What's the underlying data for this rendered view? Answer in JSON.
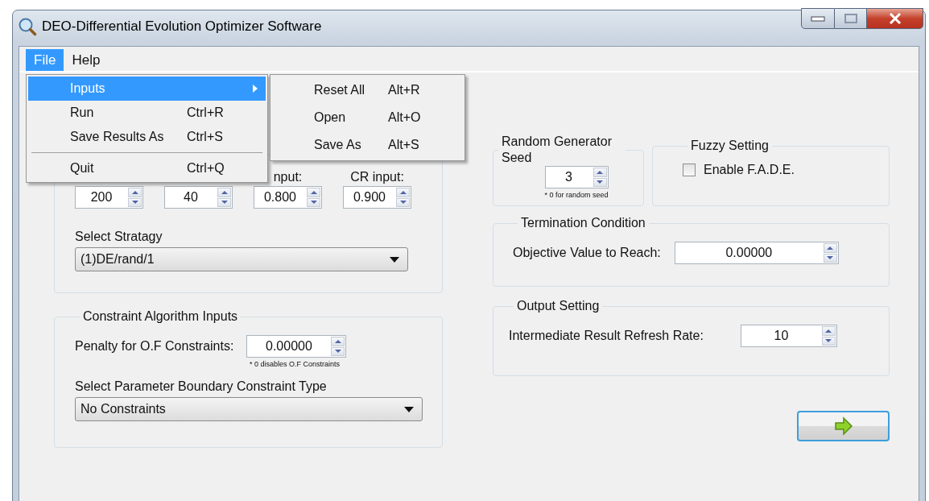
{
  "window": {
    "title": "DEO-Differential Evolution Optimizer Software"
  },
  "menu_bar": [
    {
      "label": "File",
      "selected": true
    },
    {
      "label": "Help",
      "selected": false
    }
  ],
  "file_menu": [
    {
      "kind": "submenu",
      "label": "Inputs",
      "selected": true
    },
    {
      "kind": "command",
      "label": "Run",
      "shortcut": "Ctrl+R",
      "selected": false
    },
    {
      "kind": "command",
      "label": "Save Results As",
      "shortcut": "Ctrl+S",
      "selected": false
    },
    {
      "kind": "separator"
    },
    {
      "kind": "command",
      "label": "Quit",
      "shortcut": "Ctrl+Q",
      "selected": false
    }
  ],
  "inputs_submenu": [
    {
      "label": "Reset All",
      "shortcut": "Alt+R"
    },
    {
      "label": "Open",
      "shortcut": "Alt+O"
    },
    {
      "label": "Save As",
      "shortcut": "Alt+S"
    }
  ],
  "evolution_inputs": {
    "spinners": [
      {
        "value": "200"
      },
      {
        "value": "40"
      },
      {
        "label": "nput:",
        "value": "0.800"
      },
      {
        "label": "CR input:",
        "value": "0.900"
      }
    ],
    "strategy": {
      "label": "Select Stratagy",
      "value": "(1)DE/rand/1"
    }
  },
  "constraint_inputs": {
    "title": "Constraint Algorithm Inputs",
    "penalty_label": "Penalty for O.F Constraints:",
    "penalty_value": "0.00000",
    "penalty_note": "* 0 disables O.F Constraints",
    "boundary_label": "Select Parameter Boundary Constraint Type",
    "boundary_value": "No Constraints"
  },
  "random_seed": {
    "title": "Random Generator Seed",
    "value": "3",
    "note": "* 0 for random seed"
  },
  "fuzzy_setting": {
    "title": "Fuzzy Setting",
    "checkbox_label": "Enable F.A.D.E.",
    "checked": false
  },
  "termination_condition": {
    "title": "Termination Condition",
    "label": "Objective Value to Reach:",
    "value": "0.00000"
  },
  "output_setting": {
    "title": "Output Setting",
    "label": "Intermediate Result Refresh Rate:",
    "value": "10"
  }
}
